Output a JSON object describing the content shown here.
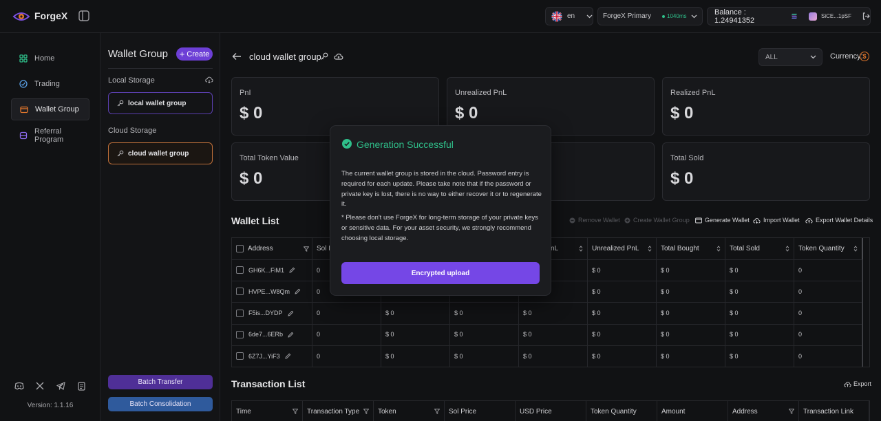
{
  "app": {
    "name": "ForgeX"
  },
  "topbar": {
    "language": "en",
    "node": "ForgeX Primary",
    "latency": "1040ms",
    "balance": "Balance : 1.24941352",
    "wallet_short": "SiCE...1pSF"
  },
  "sidebar": {
    "items": [
      {
        "label": "Home"
      },
      {
        "label": "Trading"
      },
      {
        "label": "Wallet Group"
      },
      {
        "label": "Referral Program"
      }
    ],
    "version": "Version: 1.1.16"
  },
  "wallet_group_panel": {
    "title": "Wallet Group",
    "create_label": "Create",
    "local_storage_label": "Local Storage",
    "local_group": "local wallet group",
    "cloud_storage_label": "Cloud Storage",
    "cloud_group": "cloud wallet group",
    "batch_transfer": "Batch Transfer",
    "batch_consolidation": "Batch Consolidation"
  },
  "header": {
    "group_title": "cloud wallet group",
    "filter_value": "ALL",
    "currency_label": "Currency:"
  },
  "stats": [
    {
      "label": "PnI",
      "value": "$ 0"
    },
    {
      "label": "Unrealized PnL",
      "value": "$ 0"
    },
    {
      "label": "Realized PnL",
      "value": "$ 0"
    },
    {
      "label": "Total Token Value",
      "value": "$ 0"
    },
    {
      "label": "",
      "value": ""
    },
    {
      "label": "Total Sold",
      "value": "$ 0"
    }
  ],
  "wallet_list": {
    "title": "Wallet List",
    "actions": {
      "remove": "Remove Wallet",
      "create_group": "Create Wallet Group",
      "generate": "Generate Wallet",
      "import": "Import Wallet",
      "export": "Export Wallet Details"
    },
    "columns": [
      "Address",
      "Sol B",
      "",
      "",
      "nL",
      "Unrealized PnL",
      "Total Bought",
      "Total Sold",
      "Token Quantity"
    ],
    "rows": [
      {
        "address": "GH6K...FiM1",
        "sol": "0",
        "c2": "",
        "c3": "",
        "c4": "",
        "unrealized": "$ 0",
        "bought": "$ 0",
        "sold": "$ 0",
        "qty": "0"
      },
      {
        "address": "HVPE...W8Qm",
        "sol": "0",
        "c2": "",
        "c3": "",
        "c4": "",
        "unrealized": "$ 0",
        "bought": "$ 0",
        "sold": "$ 0",
        "qty": "0"
      },
      {
        "address": "F5is...DYDP",
        "sol": "0",
        "c2": "$ 0",
        "c3": "$ 0",
        "c4": "$ 0",
        "unrealized": "$ 0",
        "bought": "$ 0",
        "sold": "$ 0",
        "qty": "0"
      },
      {
        "address": "6de7...6ERb",
        "sol": "0",
        "c2": "$ 0",
        "c3": "$ 0",
        "c4": "$ 0",
        "unrealized": "$ 0",
        "bought": "$ 0",
        "sold": "$ 0",
        "qty": "0"
      },
      {
        "address": "6Z7J...YiF3",
        "sol": "0",
        "c2": "$ 0",
        "c3": "$ 0",
        "c4": "$ 0",
        "unrealized": "$ 0",
        "bought": "$ 0",
        "sold": "$ 0",
        "qty": "0"
      }
    ]
  },
  "transaction_list": {
    "title": "Transaction List",
    "export": "Export",
    "columns": [
      "Time",
      "Transaction Type",
      "Token",
      "Sol Price",
      "USD Price",
      "Token Quantity",
      "Amount",
      "Address",
      "Transaction Link"
    ]
  },
  "modal": {
    "title": "Generation Successful",
    "paragraph1": "The current wallet group is stored in the cloud. Password entry is required for each update. Please take note that if the password or private key is lost, there is no way to either recover it or to regenerate it.",
    "paragraph2": "* Please don't use ForgeX for long-term storage of your private keys or sensitive data. For your asset security, we strongly recommend choosing local storage.",
    "button": "Encrypted upload"
  },
  "colors": {
    "accent": "#7547e6",
    "success": "#2fbf8a",
    "cloud_border": "#c0703a",
    "local_border": "#5b3fb0"
  }
}
